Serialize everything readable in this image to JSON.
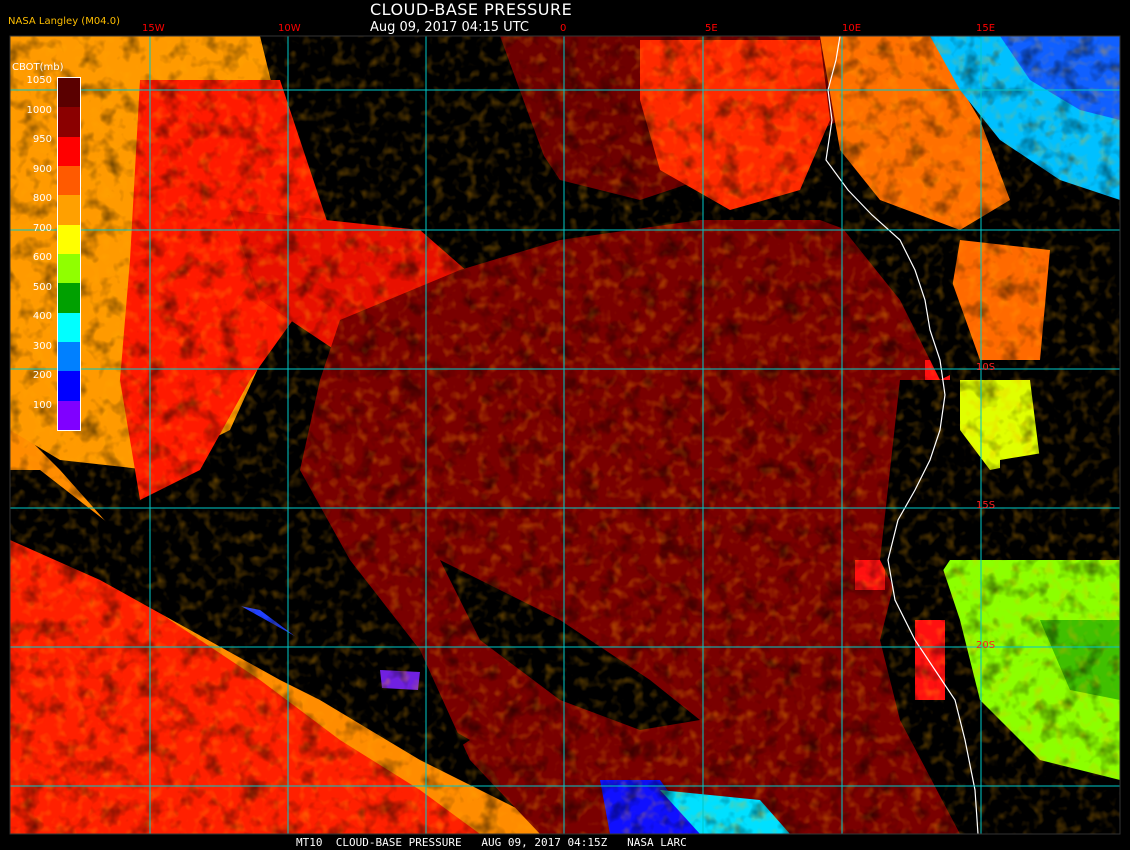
{
  "header": {
    "title": "CLOUD-BASE PRESSURE",
    "timestamp": "Aug 09, 2017 04:15 UTC",
    "source": "NASA Langley (M04.0)"
  },
  "legend": {
    "title": "CBOT(mb)",
    "ticks": [
      "1050",
      "1000",
      "950",
      "900",
      "800",
      "700",
      "600",
      "500",
      "400",
      "300",
      "200",
      "100"
    ],
    "colors": [
      "#5a0000",
      "#8b0000",
      "#ff0000",
      "#ff5a00",
      "#ffa000",
      "#ffff00",
      "#90ff00",
      "#00a000",
      "#00ffff",
      "#0080ff",
      "#0000ff",
      "#8000ff"
    ]
  },
  "grid": {
    "lon_labels": [
      "15W",
      "10W",
      "0",
      "5E",
      "10E",
      "15E"
    ],
    "lat_labels": [
      "10S",
      "15S",
      "20S"
    ]
  },
  "footer": {
    "text": "MT10  CLOUD-BASE PRESSURE   AUG 09, 2017 04:15Z   NASA LARC"
  },
  "colors": {
    "gridline": "#00c8c8",
    "coastline": "#ffffff",
    "label_red": "#ff0000"
  }
}
